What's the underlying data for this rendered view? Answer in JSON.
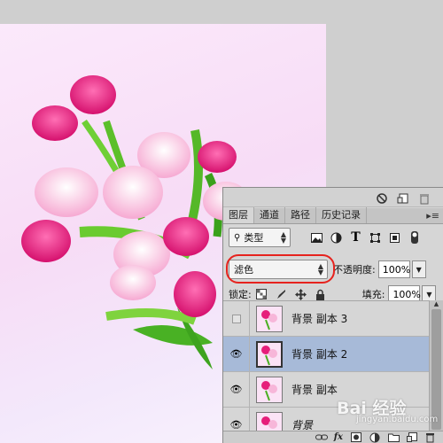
{
  "panel": {
    "tabs": [
      "图层",
      "通道",
      "路径",
      "历史记录"
    ],
    "tab_menu": "▸≡",
    "filter": {
      "label": "类型",
      "icons": [
        "image-filter-icon",
        "adjustment-filter-icon",
        "type-filter-icon",
        "shape-filter-icon",
        "smart-object-filter-icon",
        "filter-toggle-icon"
      ]
    },
    "blend_mode": "滤色",
    "opacity_label": "不透明度:",
    "opacity_value": "100%",
    "lock_label": "锁定:",
    "fill_label": "填充:",
    "fill_value": "100%"
  },
  "layers": [
    {
      "name": "背景 副本 3",
      "visible": false,
      "selected": false
    },
    {
      "name": "背景 副本 2",
      "visible": true,
      "selected": true
    },
    {
      "name": "背景 副本",
      "visible": true,
      "selected": false
    },
    {
      "name": "背景",
      "visible": true,
      "selected": false
    }
  ],
  "bottom_bar": {
    "fx_label": "fx"
  },
  "watermark": {
    "brand": "Bai 经验",
    "sub": "jingyan.baidu.com"
  },
  "colors": {
    "selection": "#a7bad8",
    "highlight_ring": "#e6231e",
    "tulip_pink": "#e61e7a",
    "leaf_green": "#4caf24"
  }
}
